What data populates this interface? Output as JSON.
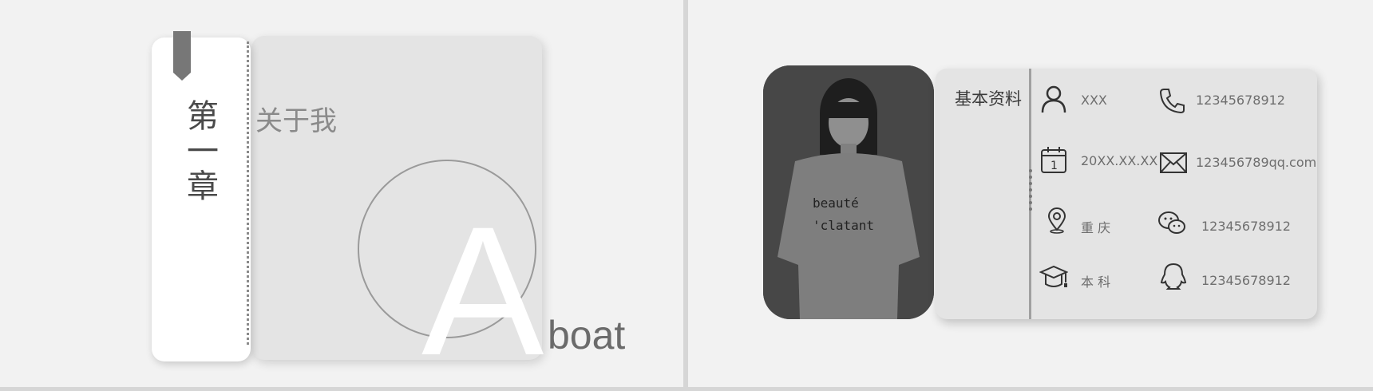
{
  "left_slide": {
    "chapter_label": "第一章",
    "section_title": "关于我",
    "big_letter": "A",
    "subtitle_word": "boat"
  },
  "right_slide": {
    "header": "基本资料",
    "fields": {
      "name": "XXX",
      "phone": "12345678912",
      "birthday": "20XX.XX.XX",
      "email": "123456789qq.com",
      "location": "重 庆",
      "wechat": "12345678912",
      "education": "本 科",
      "qq": "12345678912"
    },
    "photo_shirt_text_1": "beauté",
    "photo_shirt_text_2": "'clatant"
  },
  "colors": {
    "background": "#f2f2f2",
    "card": "#e4e4e4",
    "accent": "#6b6b6b"
  }
}
